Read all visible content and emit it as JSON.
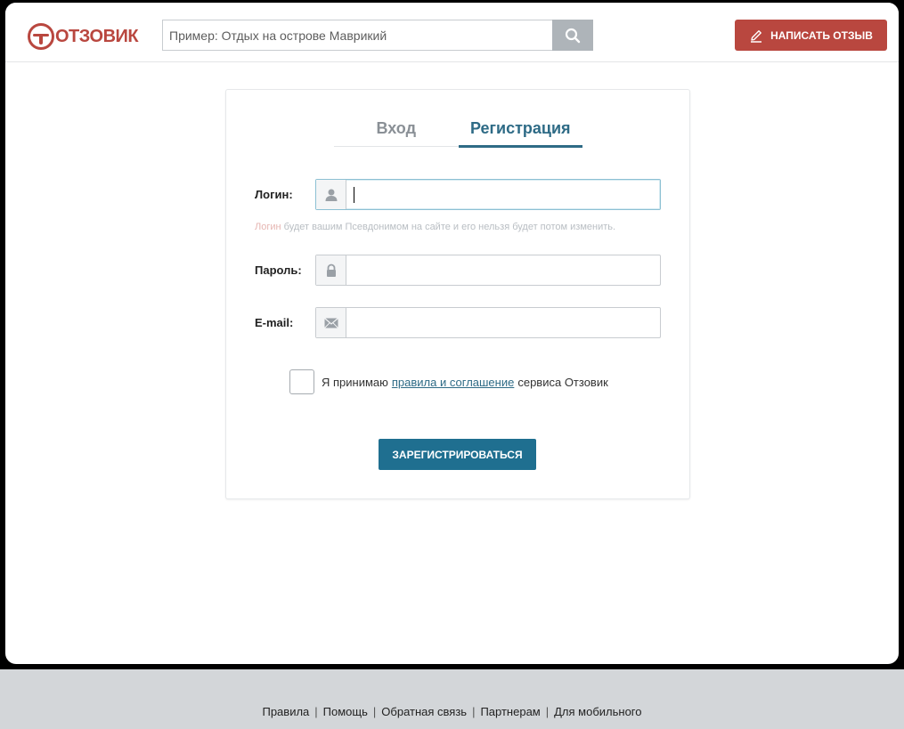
{
  "colors": {
    "brand": "#b9473f",
    "accent": "#2e6b86",
    "button": "#1f6f90",
    "footer_bg": "#d3d6d9"
  },
  "header": {
    "logo_text": "ОТЗОВИК",
    "search_placeholder": "Пример: Отдых на острове Маврикий",
    "search_icon": "search-icon",
    "write_review_label": "НАПИСАТЬ ОТЗЫВ",
    "write_review_icon": "pen-icon"
  },
  "tabs": [
    {
      "label": "Вход",
      "active": false
    },
    {
      "label": "Регистрация",
      "active": true
    }
  ],
  "form": {
    "login_label": "Логин:",
    "login_value": "",
    "login_icon": "user-icon",
    "hint_accent": "Логин",
    "hint_rest": " будет вашим Псевдонимом на сайте и его нельзя будет потом изменить.",
    "password_label": "Пароль:",
    "password_value": "",
    "password_icon": "lock-icon",
    "email_label": "E-mail:",
    "email_value": "",
    "email_icon": "envelope-icon",
    "agree_prefix": "Я принимаю",
    "agree_link": "правила и соглашение",
    "agree_suffix": "сервиса Отзовик",
    "agree_checked": false,
    "submit_label": "ЗАРЕГИСТРИРОВАТЬСЯ"
  },
  "footer": {
    "links": [
      "Правила",
      "Помощь",
      "Обратная связь",
      "Партнерам",
      "Для мобильного"
    ],
    "separator": "|"
  }
}
